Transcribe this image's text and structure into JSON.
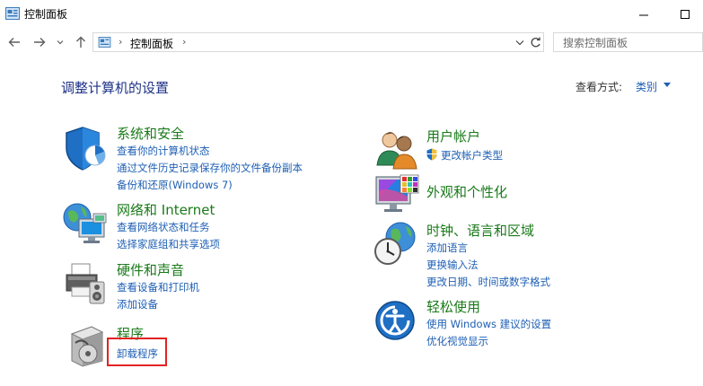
{
  "window": {
    "title": "控制面板"
  },
  "address": {
    "crumb": "控制面板"
  },
  "search": {
    "placeholder": "搜索控制面板"
  },
  "main": {
    "heading": "调整计算机的设置",
    "view_by_label": "查看方式:",
    "view_by_value": "类别"
  },
  "categories": {
    "system_security": {
      "title": "系统和安全",
      "links": [
        "查看你的计算机状态",
        "通过文件历史记录保存你的文件备份副本",
        "备份和还原(Windows 7)"
      ]
    },
    "network": {
      "title": "网络和 Internet",
      "links": [
        "查看网络状态和任务",
        "选择家庭组和共享选项"
      ]
    },
    "hardware": {
      "title": "硬件和声音",
      "links": [
        "查看设备和打印机",
        "添加设备"
      ]
    },
    "programs": {
      "title": "程序",
      "links": [
        "卸载程序"
      ]
    },
    "user_accounts": {
      "title": "用户帐户",
      "links": [
        "更改帐户类型"
      ]
    },
    "appearance": {
      "title": "外观和个性化",
      "links": []
    },
    "clock": {
      "title": "时钟、语言和区域",
      "links": [
        "添加语言",
        "更换输入法",
        "更改日期、时间或数字格式"
      ]
    },
    "ease": {
      "title": "轻松使用",
      "links": [
        "使用 Windows 建议的设置",
        "优化视觉显示"
      ]
    }
  },
  "colors": {
    "heading": "#1e3287",
    "category_title": "#1a7a1a",
    "link": "#1e5fb4",
    "highlight": "#e32222"
  }
}
